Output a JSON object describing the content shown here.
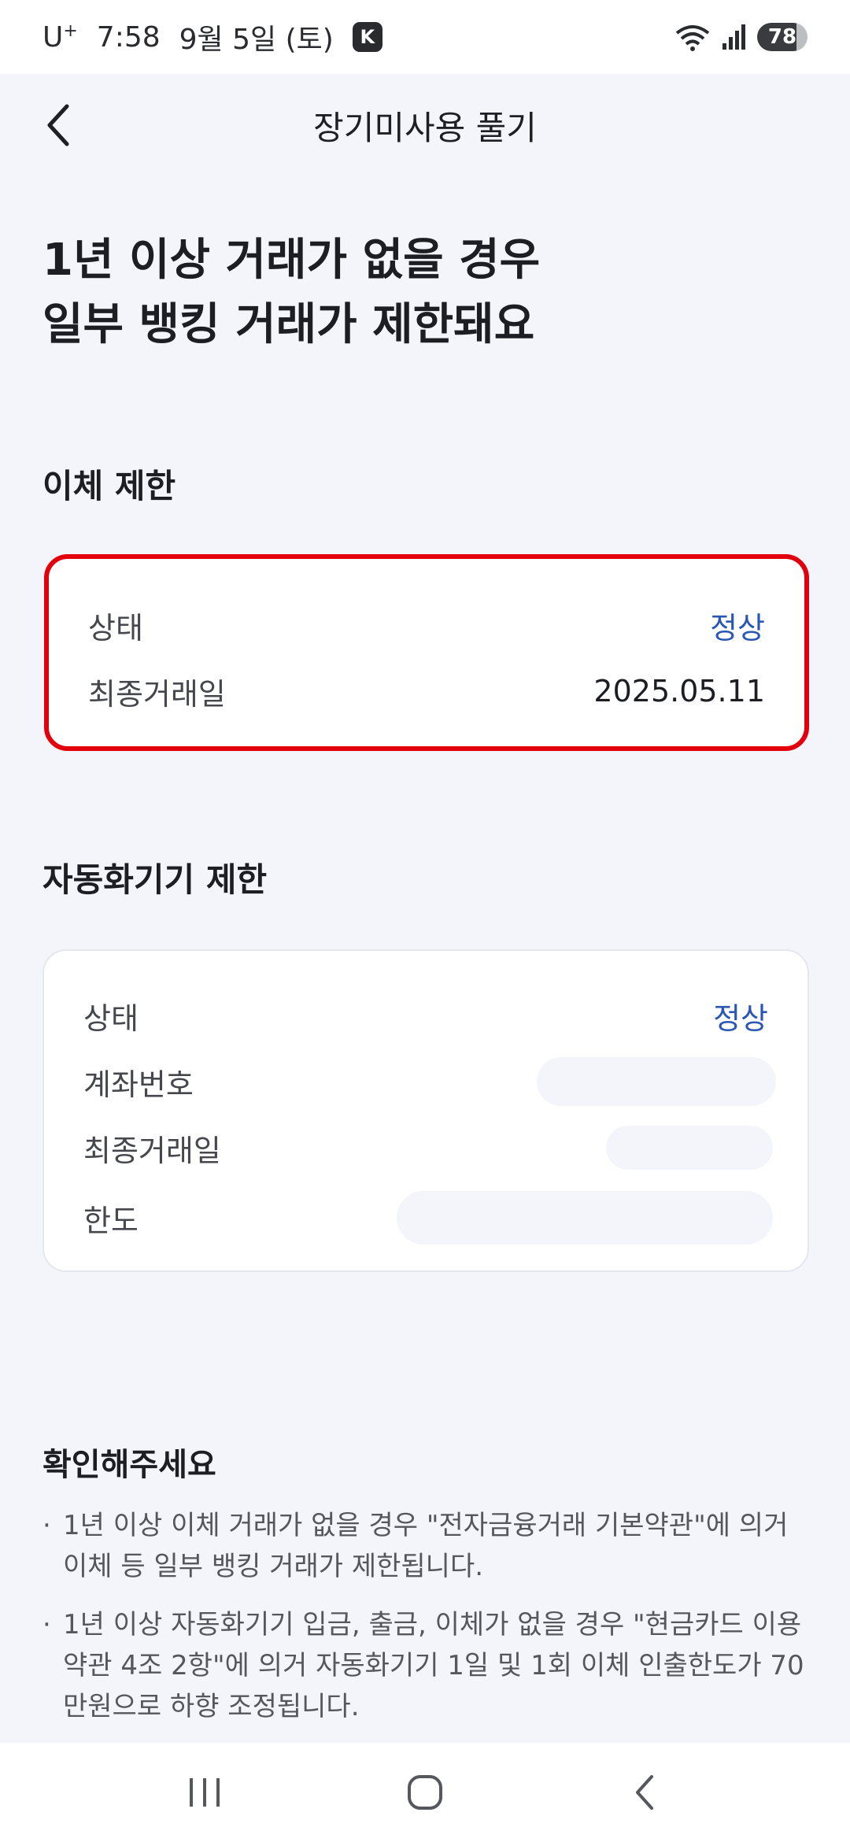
{
  "status_bar": {
    "carrier": "U",
    "carrier_sup": "+",
    "time": "7:58",
    "date": "9월 5일 (토)",
    "app_badge": "K",
    "battery": "78"
  },
  "header": {
    "title": "장기미사용 풀기"
  },
  "headline": {
    "line1": "1년 이상 거래가 없을 경우",
    "line2": "일부 뱅킹 거래가 제한돼요"
  },
  "transfer_section": {
    "title": "이체 제한",
    "rows": [
      {
        "label": "상태",
        "value": "정상"
      },
      {
        "label": "최종거래일",
        "value": "2025.05.11"
      }
    ]
  },
  "atm_section": {
    "title": "자동화기기 제한",
    "rows": [
      {
        "label": "상태",
        "value": "정상"
      },
      {
        "label": "계좌번호"
      },
      {
        "label": "최종거래일"
      },
      {
        "label": "한도"
      }
    ]
  },
  "notice": {
    "title": "확인해주세요",
    "items": [
      "1년 이상 이체 거래가 없을 경우 \"전자금융거래 기본약관\"에 의거 이체 등 일부 뱅킹 거래가 제한됩니다.",
      "1년 이상 자동화기기 입금, 출금, 이체가 없을 경우 \"현금카드 이용약관 4조 2항\"에 의거 자동화기기 1일 및 1회 이체 인출한도가 70만원으로 하향 조정됩니다."
    ]
  },
  "colors": {
    "accent_blue": "#2A56B4",
    "highlight_red": "#E1000B",
    "background": "#F4F5FA"
  }
}
